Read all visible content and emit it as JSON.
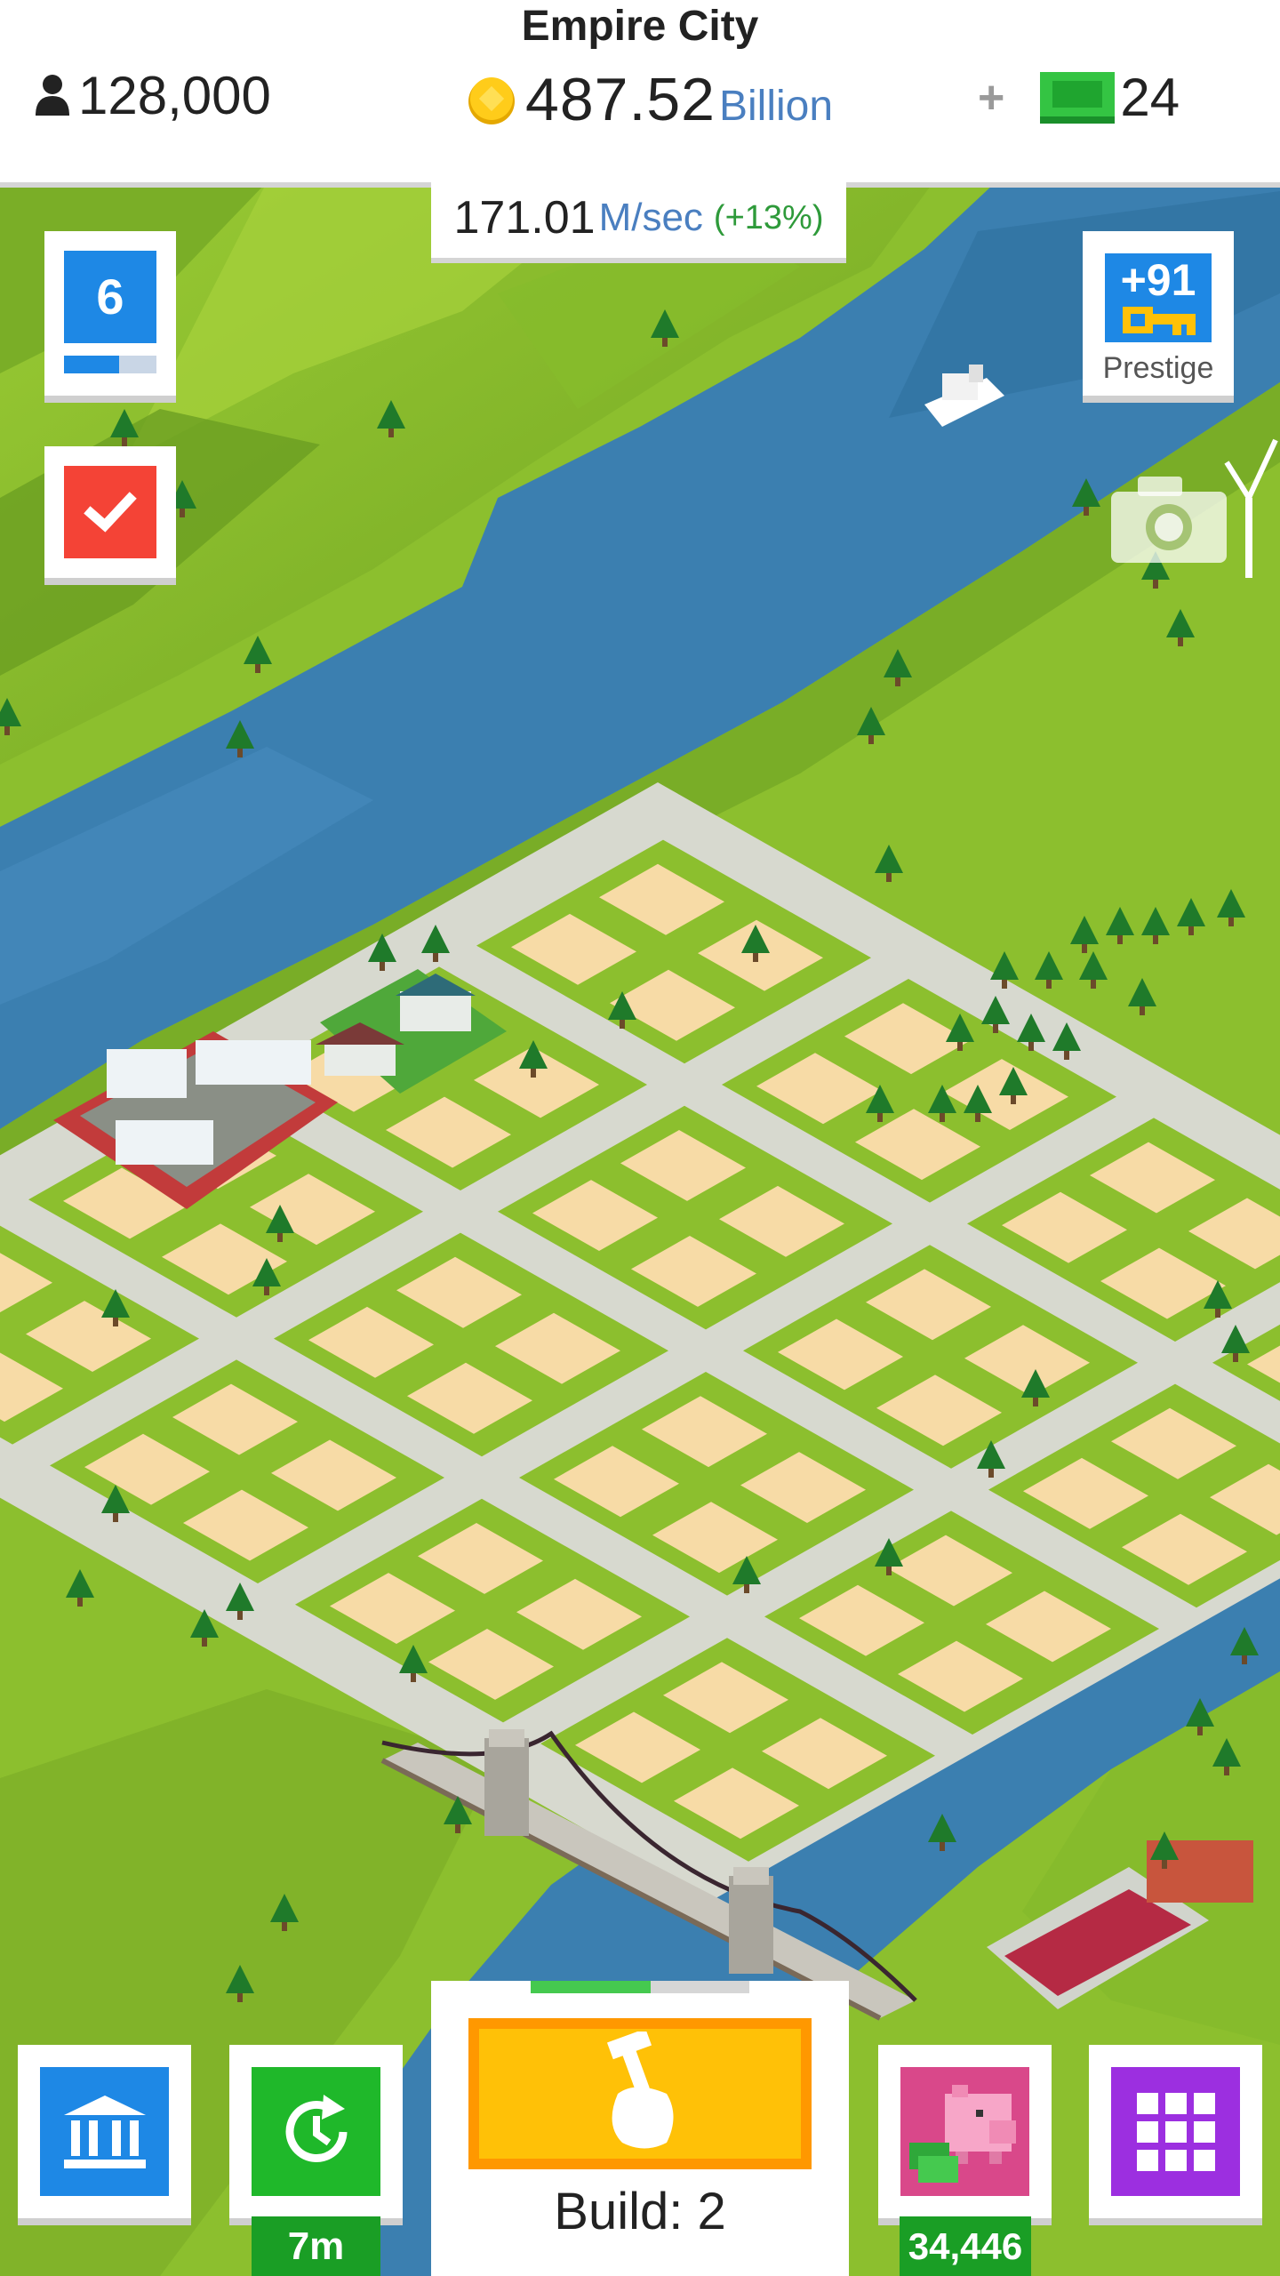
{
  "header": {
    "city_name": "Empire City",
    "population": "128,000",
    "money_value": "487.52",
    "money_unit": "Billion",
    "add_label": "+",
    "gems": "24"
  },
  "income": {
    "rate_value": "171.01",
    "rate_unit": "M/sec",
    "bonus": "(+13%)"
  },
  "level": {
    "number": "6",
    "progress_fraction": 0.6
  },
  "prestige": {
    "bonus": "+91",
    "label": "Prestige"
  },
  "bottom_bar": {
    "boost_timer": "7m",
    "build_label": "Build: 2",
    "build_progress_fraction": 0.55,
    "piggy_bank_count": "34,446"
  },
  "colors": {
    "blue_button": "#1e88e5",
    "red_button": "#f44336",
    "green_button": "#1fb82a",
    "build_yellow": "#ffc107",
    "build_orange": "#ff9800",
    "purple_button": "#9c2fe0",
    "water": "#3b7fb0",
    "grass": "#8cbf2e",
    "road": "#d7d9cf",
    "lot": "#f7dba6"
  },
  "icons": {
    "population": "person-icon",
    "money": "coin-icon",
    "gems": "cash-bill-icon",
    "tasks": "checkmark-icon",
    "prestige": "key-icon",
    "camera": "camera-icon",
    "bank": "bank-icon",
    "boost": "clock-refresh-icon",
    "build": "hammer-hand-icon",
    "piggy": "piggy-bank-icon",
    "menu": "grid-menu-icon"
  }
}
